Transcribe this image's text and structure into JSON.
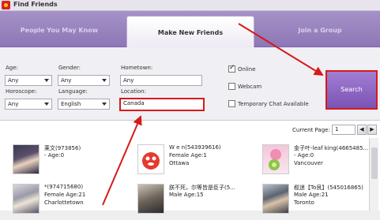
{
  "window": {
    "title": "Find Friends"
  },
  "tabs": [
    {
      "label": "People You May Know"
    },
    {
      "label": "Make New Friends"
    },
    {
      "label": "Join a Group"
    }
  ],
  "form": {
    "age_label": "Age:",
    "age_value": "Any",
    "gender_label": "Gender:",
    "gender_value": "Any",
    "horoscope_label": "Horoscope:",
    "horoscope_value": "Any",
    "language_label": "Language:",
    "language_value": "English",
    "hometown_label": "Hometown:",
    "hometown_value": "Any",
    "location_label": "Location:",
    "location_value": "Canada",
    "online_label": "Online",
    "online_checked": true,
    "webcam_label": "Webcam",
    "webcam_checked": false,
    "tempchat_label": "Temporary Chat Available",
    "tempchat_checked": false,
    "search_label": "Search"
  },
  "pagination": {
    "label": "Current Page:",
    "value": "1",
    "prev": "◀",
    "next": "▶"
  },
  "results": [
    {
      "name": "莱文(973856)",
      "info": "- Age:0",
      "location": ""
    },
    {
      "name": "W e n(543939616)",
      "info": "Female Age:1",
      "location": "Ottawa"
    },
    {
      "name": "金子叶-leaf king(4665485...",
      "info": "- Age:0",
      "location": "Vancouver"
    },
    {
      "name": "*(974715680)",
      "info": "Female Age:21",
      "location": "Charlottetown"
    },
    {
      "name": "朕不死，尔等皆是臣子(5...",
      "info": "Male Age:15",
      "location": ""
    },
    {
      "name": "榄迷【To艮】(545016865)",
      "info": "Male Age:21",
      "location": "Toronto"
    }
  ],
  "colors": {
    "tab_bg": "#8d77b6",
    "search_btn": "#8b63c4",
    "annotation": "#d61a1a"
  }
}
